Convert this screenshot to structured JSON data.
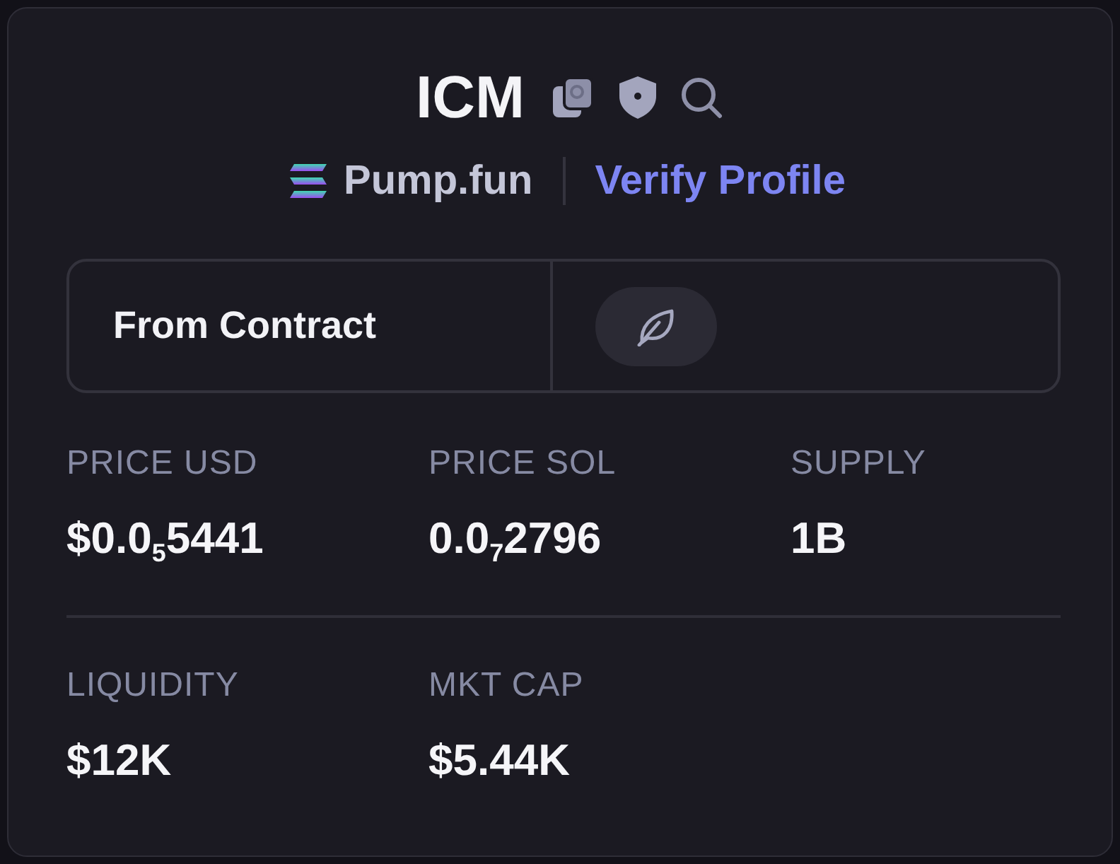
{
  "token": {
    "symbol": "ICM"
  },
  "source": {
    "platform": "Pump.fun",
    "verify_link": "Verify Profile"
  },
  "contract": {
    "label": "From Contract"
  },
  "stats": [
    {
      "items": [
        {
          "label": "PRICE USD",
          "value": "$0.0$_{5}$5441"
        },
        {
          "label": "PRICE SOL",
          "value": "0.0$_{7}$2796"
        },
        {
          "label": "SUPPLY",
          "value": "1B"
        }
      ]
    },
    {
      "items": [
        {
          "label": "LIQUIDITY",
          "value": "$12K"
        },
        {
          "label": "MKT CAP",
          "value": "$5.44K"
        }
      ]
    }
  ]
}
